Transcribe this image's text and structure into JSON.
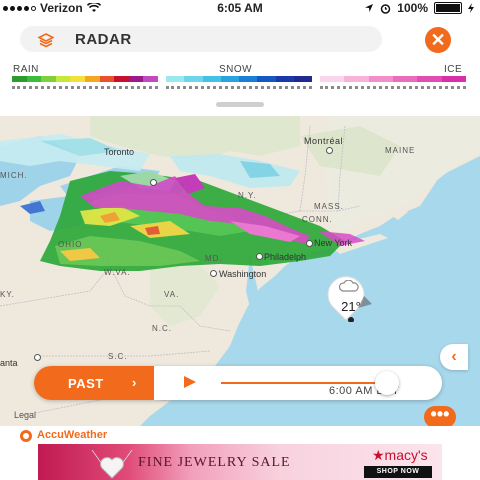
{
  "status_bar": {
    "carrier": "Verizon",
    "time": "6:05 AM",
    "battery": "100%",
    "signal_bars_filled": 4,
    "signal_bars_total": 5
  },
  "header": {
    "title": "RADAR",
    "close_icon": "close-icon",
    "layers_icon": "layers-icon"
  },
  "legend": {
    "rain_label": "RAIN",
    "snow_label": "SNOW",
    "ice_label": "ICE",
    "rain_colors": [
      "#2e9b2e",
      "#3dbb3d",
      "#7fd13b",
      "#c6e83a",
      "#f3e03a",
      "#f5a623",
      "#e8512b",
      "#c8102e",
      "#9b1b8c",
      "#c04ac0"
    ],
    "snow_colors": [
      "#9be8ef",
      "#6fd6ea",
      "#44c2e6",
      "#2aa3e0",
      "#1b7fd6",
      "#1657c2",
      "#1a3aa8",
      "#1f2b8f"
    ],
    "ice_colors": [
      "#fad4ea",
      "#f6b4da",
      "#f08fcc",
      "#ea6cbf",
      "#e04db3",
      "#d830a8"
    ]
  },
  "map": {
    "labels": {
      "montreal": "Montréal",
      "maine": "MAINE",
      "toronto": "Toronto",
      "mich": "MICH.",
      "ny": "N.Y.",
      "mass": "MASS.",
      "conn": "CONN.",
      "new_york": "New York",
      "ohio": "OHIO",
      "md": "MD.",
      "philadelphia": "Philadelph",
      "washington": "Washington",
      "wva": "W.VA.",
      "ky": "KY.",
      "va": "VA.",
      "nc": "N.C.",
      "sc": "S.C.",
      "atlanta": "anta"
    },
    "pin": {
      "temperature": "21°",
      "condition_icon": "cloudy-icon"
    },
    "side_button": "‹"
  },
  "player": {
    "past_label": "PAST",
    "chevron": "›",
    "time": "6:00 AM EST",
    "progress": 0.93
  },
  "footer": {
    "legal": "Legal",
    "more": "•••",
    "brand": "AccuWeather"
  },
  "ad": {
    "headline": "FINE JEWELRY SALE",
    "brand": "★macy's",
    "cta": "SHOP NOW"
  }
}
